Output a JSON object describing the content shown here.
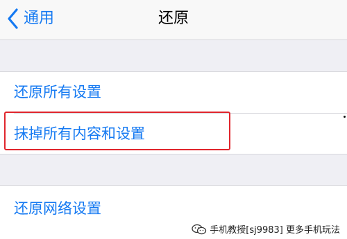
{
  "navbar": {
    "back_label": "通用",
    "title": "还原"
  },
  "groups": [
    {
      "items": [
        {
          "label": "还原所有设置"
        },
        {
          "label": "抹掉所有内容和设置"
        }
      ]
    },
    {
      "items": [
        {
          "label": "还原网络设置"
        }
      ]
    }
  ],
  "highlight": {
    "color": "#e0252c"
  },
  "watermark": {
    "icon": "wechat-icon",
    "text": "手机教授[sj9983]  更多手机玩法"
  },
  "colors": {
    "accent": "#1479f2",
    "background": "#efeff4",
    "cell": "#ffffff"
  }
}
